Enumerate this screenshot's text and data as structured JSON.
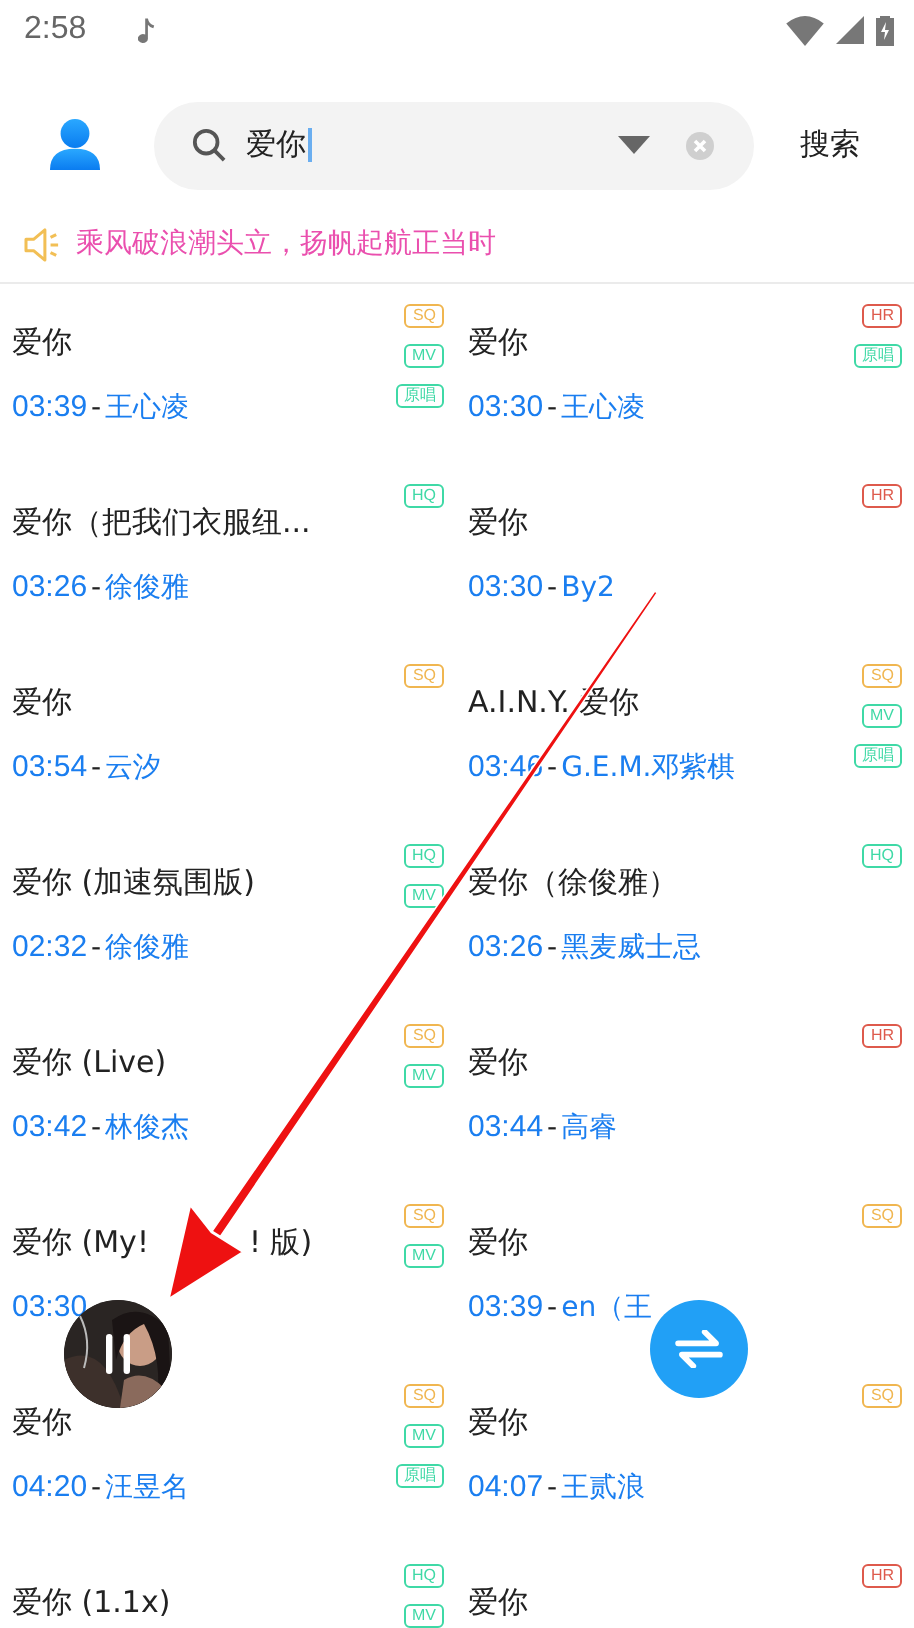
{
  "status_bar": {
    "time": "2:58"
  },
  "search": {
    "value": "爱你",
    "button": "搜索"
  },
  "notice": {
    "text": "乘风破浪潮头立，扬帆起航正当时"
  },
  "results": [
    {
      "title": "爱你",
      "duration": "03:39",
      "sep": "-",
      "artist": "王心凌",
      "badges": [
        {
          "label": "SQ",
          "kind": "sq"
        },
        {
          "label": "MV",
          "kind": "mv"
        },
        {
          "label": "原唱",
          "kind": "orig"
        }
      ]
    },
    {
      "title": "爱你",
      "duration": "03:30",
      "sep": "-",
      "artist": "王心凌",
      "badges": [
        {
          "label": "HR",
          "kind": "hr"
        },
        {
          "label": "原唱",
          "kind": "orig"
        }
      ]
    },
    {
      "title": "爱你（把我们衣服纽...",
      "duration": "03:26",
      "sep": "-",
      "artist": "徐俊雅",
      "badges": [
        {
          "label": "HQ",
          "kind": "hq"
        }
      ]
    },
    {
      "title": "爱你",
      "duration": "03:30",
      "sep": "-",
      "artist": "By2",
      "badges": [
        {
          "label": "HR",
          "kind": "hr"
        }
      ]
    },
    {
      "title": "爱你",
      "duration": "03:54",
      "sep": "-",
      "artist": "云汐",
      "badges": [
        {
          "label": "SQ",
          "kind": "sq"
        }
      ]
    },
    {
      "title": "A.I.N.Y. 爱你",
      "duration": "03:46",
      "sep": "-",
      "artist": "G.E.M.邓紫棋",
      "badges": [
        {
          "label": "SQ",
          "kind": "sq"
        },
        {
          "label": "MV",
          "kind": "mv"
        },
        {
          "label": "原唱",
          "kind": "orig"
        }
      ]
    },
    {
      "title": "爱你 (加速氛围版)",
      "duration": "02:32",
      "sep": "-",
      "artist": "徐俊雅",
      "badges": [
        {
          "label": "HQ",
          "kind": "hq"
        },
        {
          "label": "MV",
          "kind": "mv"
        }
      ]
    },
    {
      "title": "爱你（徐俊雅）",
      "duration": "03:26",
      "sep": "-",
      "artist": "黑麦威士忌",
      "badges": [
        {
          "label": "HQ",
          "kind": "hq"
        }
      ]
    },
    {
      "title": "爱你 (Live)",
      "duration": "03:42",
      "sep": "-",
      "artist": "林俊杰",
      "badges": [
        {
          "label": "SQ",
          "kind": "sq"
        },
        {
          "label": "MV",
          "kind": "mv"
        }
      ]
    },
    {
      "title": "爱你",
      "duration": "03:44",
      "sep": "-",
      "artist": "高睿",
      "badges": [
        {
          "label": "HR",
          "kind": "hr"
        }
      ]
    },
    {
      "title": "爱你 (My!",
      "title_rest": "! 版)",
      "duration": "03:30",
      "badges": [
        {
          "label": "SQ",
          "kind": "sq"
        },
        {
          "label": "MV",
          "kind": "mv"
        }
      ]
    },
    {
      "title": "爱你",
      "duration": "03:39",
      "sep": "-",
      "artist": "en（王",
      "badges": [
        {
          "label": "SQ",
          "kind": "sq"
        }
      ]
    },
    {
      "title": "爱你",
      "duration": "04:20",
      "sep": "-",
      "artist": "汪昱名",
      "badges": [
        {
          "label": "SQ",
          "kind": "sq"
        },
        {
          "label": "MV",
          "kind": "mv"
        },
        {
          "label": "原唱",
          "kind": "orig"
        }
      ]
    },
    {
      "title": "爱你",
      "duration": "04:07",
      "sep": "-",
      "artist": "王贰浪",
      "badges": [
        {
          "label": "SQ",
          "kind": "sq"
        }
      ]
    },
    {
      "title": "爱你 (1.1x)",
      "badges": [
        {
          "label": "HQ",
          "kind": "hq"
        },
        {
          "label": "MV",
          "kind": "mv"
        }
      ]
    },
    {
      "title": "爱你",
      "badges": [
        {
          "label": "HR",
          "kind": "hr"
        }
      ]
    }
  ]
}
